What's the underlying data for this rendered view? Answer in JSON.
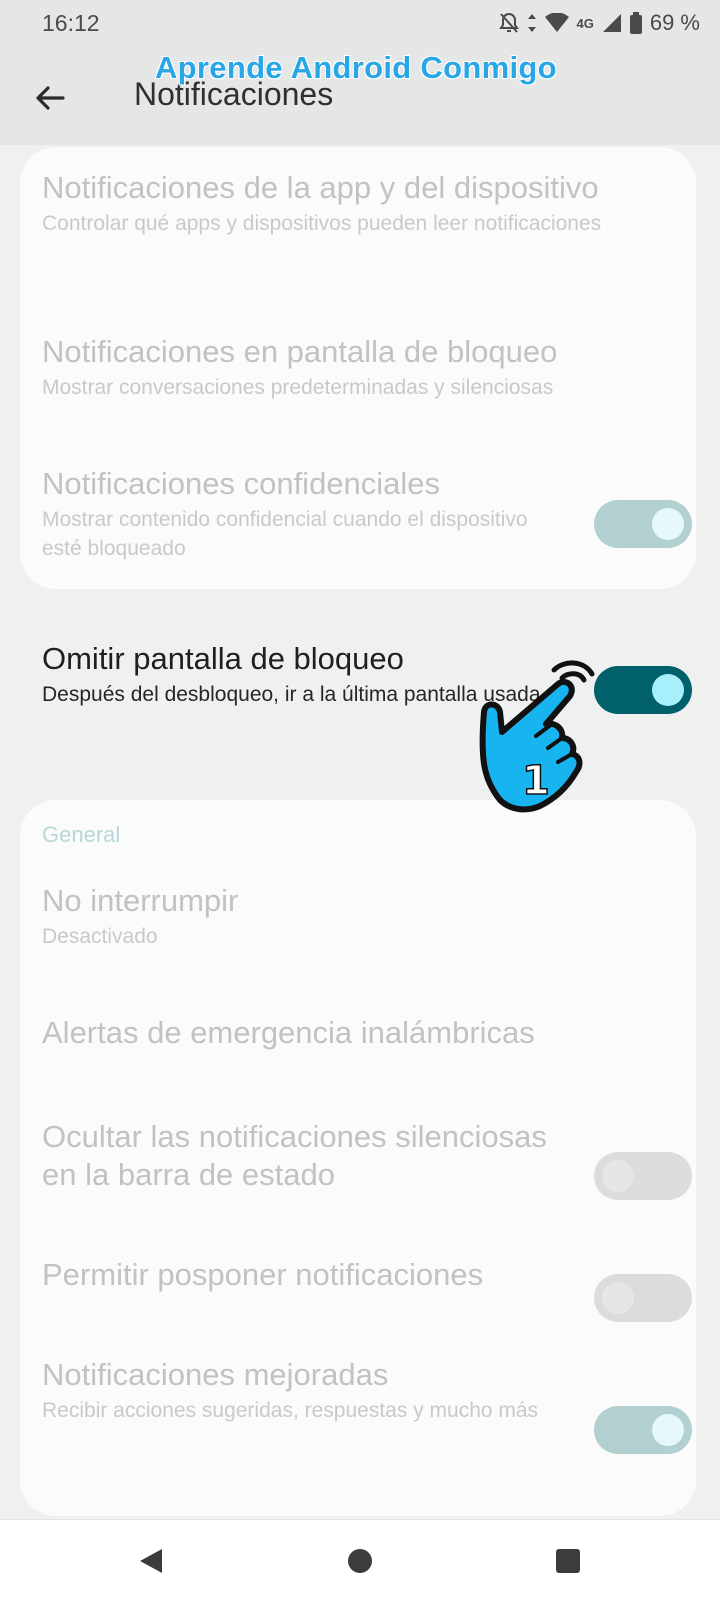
{
  "status_bar": {
    "time": "16:12",
    "network": "4G",
    "battery": "69 %"
  },
  "watermark": "Aprende Android Conmigo",
  "header": {
    "title": "Notificaciones"
  },
  "card_top": {
    "items": [
      {
        "title": "Notificaciones de la app y del dispositivo",
        "subtitle": "Controlar qué apps y dispositivos pueden leer notificaciones"
      },
      {
        "title": "Notificaciones en pantalla de bloqueo",
        "subtitle": "Mostrar conversaciones predeterminadas y silenciosas"
      },
      {
        "title": "Notificaciones confidenciales",
        "subtitle": "Mostrar contenido confidencial cuando el dispositivo esté bloqueado",
        "toggle": "on"
      }
    ]
  },
  "lock_screen_skip": {
    "title": "Omitir pantalla de bloqueo",
    "subtitle": "Después del desbloqueo, ir a la última pantalla usada",
    "toggle": "on"
  },
  "annotation": {
    "step_number": "1"
  },
  "general": {
    "header": "General",
    "items": [
      {
        "title": "No interrumpir",
        "subtitle": "Desactivado"
      },
      {
        "title": "Alertas de emergencia inalámbricas"
      },
      {
        "title": "Ocultar las notificaciones silenciosas en la barra de estado",
        "toggle": "off"
      },
      {
        "title": "Permitir posponer notificaciones",
        "toggle": "off"
      },
      {
        "title": "Notificaciones mejoradas",
        "subtitle": "Recibir acciones sugeridas, respuestas y mucho más",
        "toggle": "on"
      }
    ]
  },
  "colors": {
    "accent": "#00606c",
    "watermark": "#29a6e6",
    "section_header": "#b8d7d9"
  }
}
